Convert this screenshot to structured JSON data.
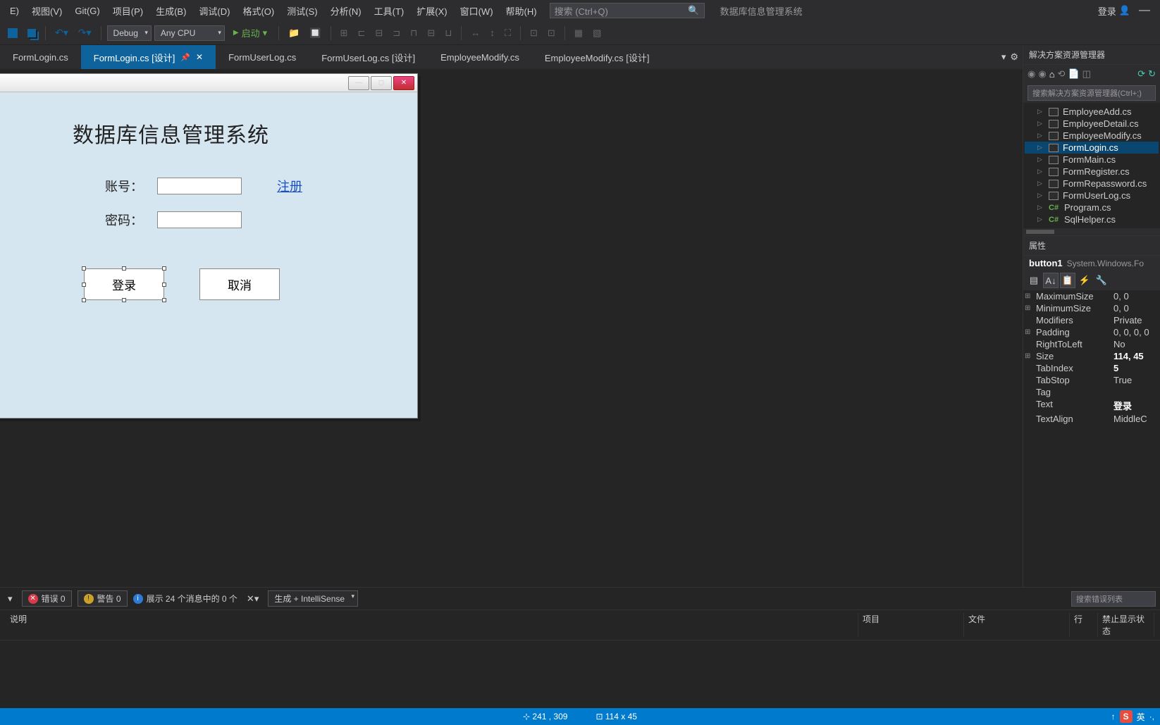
{
  "menu": {
    "items": [
      "E)",
      "视图(V)",
      "Git(G)",
      "项目(P)",
      "生成(B)",
      "调试(D)",
      "格式(O)",
      "测试(S)",
      "分析(N)",
      "工具(T)",
      "扩展(X)",
      "窗口(W)",
      "帮助(H)"
    ]
  },
  "search": {
    "placeholder": "搜索 (Ctrl+Q)"
  },
  "appTitle": "数据库信息管理系统",
  "login": {
    "label": "登录"
  },
  "toolbar": {
    "config": "Debug",
    "platform": "Any CPU",
    "start": "启动"
  },
  "tabs": {
    "items": [
      {
        "label": "FormLogin.cs",
        "active": false
      },
      {
        "label": "FormLogin.cs [设计]",
        "active": true,
        "pinned": true
      },
      {
        "label": "FormUserLog.cs",
        "active": false
      },
      {
        "label": "FormUserLog.cs [设计]",
        "active": false
      },
      {
        "label": "EmployeeModify.cs",
        "active": false
      },
      {
        "label": "EmployeeModify.cs [设计]",
        "active": false
      }
    ]
  },
  "winform": {
    "title": "数据库信息管理系统",
    "accountLabel": "账号：",
    "passwordLabel": "密码：",
    "registerLink": "注册",
    "loginButton": "登录",
    "cancelButton": "取消"
  },
  "solutionExplorer": {
    "title": "解决方案资源管理器",
    "searchPlaceholder": "搜索解决方案资源管理器(Ctrl+;)",
    "files": [
      {
        "name": "EmployeeAdd.cs",
        "type": "form"
      },
      {
        "name": "EmployeeDetail.cs",
        "type": "form"
      },
      {
        "name": "EmployeeModify.cs",
        "type": "form"
      },
      {
        "name": "FormLogin.cs",
        "type": "form",
        "selected": true
      },
      {
        "name": "FormMain.cs",
        "type": "form"
      },
      {
        "name": "FormRegister.cs",
        "type": "form"
      },
      {
        "name": "FormRepassword.cs",
        "type": "form"
      },
      {
        "name": "FormUserLog.cs",
        "type": "form"
      },
      {
        "name": "Program.cs",
        "type": "cs"
      },
      {
        "name": "SqlHelper.cs",
        "type": "cs"
      }
    ]
  },
  "properties": {
    "title": "属性",
    "objectName": "button1",
    "objectType": "System.Windows.Fo",
    "items": [
      {
        "key": "MaximumSize",
        "val": "0, 0",
        "expand": true
      },
      {
        "key": "MinimumSize",
        "val": "0, 0",
        "expand": true
      },
      {
        "key": "Modifiers",
        "val": "Private"
      },
      {
        "key": "Padding",
        "val": "0, 0, 0, 0",
        "expand": true
      },
      {
        "key": "RightToLeft",
        "val": "No"
      },
      {
        "key": "Size",
        "val": "114, 45",
        "expand": true,
        "bold": true
      },
      {
        "key": "TabIndex",
        "val": "5",
        "bold": true
      },
      {
        "key": "TabStop",
        "val": "True"
      },
      {
        "key": "Tag",
        "val": ""
      },
      {
        "key": "Text",
        "val": "登录",
        "bold": true
      },
      {
        "key": "TextAlign",
        "val": "MiddleC"
      }
    ]
  },
  "errorList": {
    "errors": "错误 0",
    "warnings": "警告 0",
    "messages": "展示 24 个消息中的 0 个",
    "filter": "生成 + IntelliSense",
    "searchPlaceholder": "搜索错误列表",
    "headers": [
      "说明",
      "项目",
      "文件",
      "行",
      "禁止显示状态"
    ]
  },
  "statusbar": {
    "position": "241 , 309",
    "size": "114 x 45",
    "ime": "英"
  }
}
